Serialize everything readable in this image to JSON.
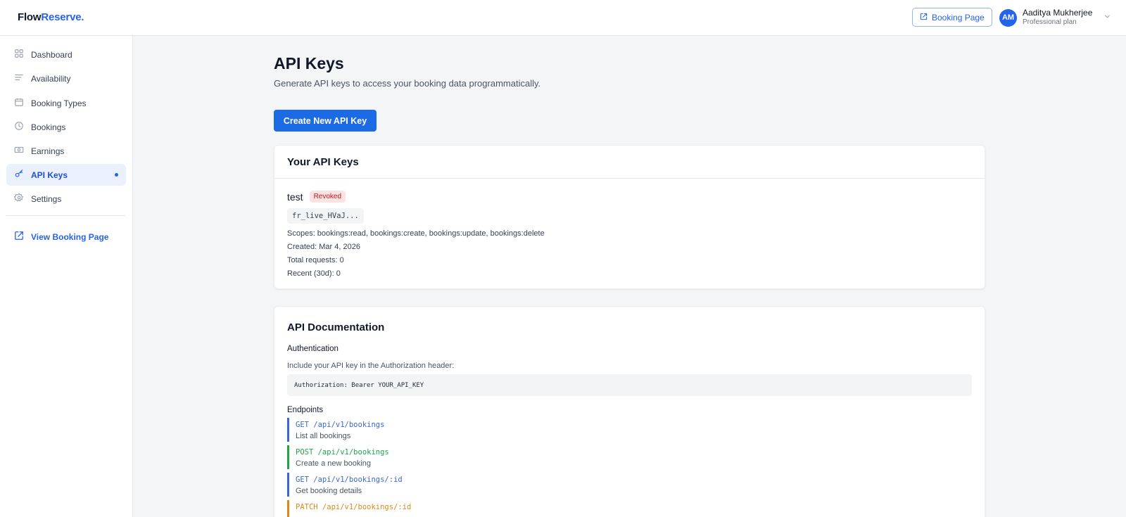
{
  "header": {
    "logo_part1": "Flow",
    "logo_part2": "Reserve.",
    "booking_button": "Booking Page",
    "user": {
      "initials": "AM",
      "name": "Aaditya Mukherjee",
      "plan": "Professional plan"
    }
  },
  "sidebar": {
    "items": [
      {
        "label": "Dashboard",
        "icon": "grid-icon"
      },
      {
        "label": "Availability",
        "icon": "lines-icon"
      },
      {
        "label": "Booking Types",
        "icon": "calendar-icon"
      },
      {
        "label": "Bookings",
        "icon": "clock-icon"
      },
      {
        "label": "Earnings",
        "icon": "money-icon"
      },
      {
        "label": "API Keys",
        "icon": "key-icon",
        "active": true
      },
      {
        "label": "Settings",
        "icon": "gear-icon"
      }
    ],
    "view_link": "View Booking Page"
  },
  "main": {
    "title": "API Keys",
    "subtitle": "Generate API keys to access your booking data programmatically.",
    "create_button": "Create New API Key",
    "keys_card": {
      "title": "Your API Keys",
      "key": {
        "name": "test",
        "status": "Revoked",
        "prefix": "fr_live_HVaJ...",
        "scopes": "Scopes: bookings:read, bookings:create, bookings:update, bookings:delete",
        "created": "Created: Mar 4, 2026",
        "total_requests": "Total requests: 0",
        "recent": "Recent (30d): 0"
      }
    },
    "docs_card": {
      "title": "API Documentation",
      "auth_heading": "Authentication",
      "auth_text": "Include your API key in the Authorization header:",
      "auth_code": "Authorization: Bearer YOUR_API_KEY",
      "endpoints_heading": "Endpoints",
      "endpoints": [
        {
          "code": "GET /api/v1/bookings",
          "desc": "List all bookings",
          "color": "#3b66d6"
        },
        {
          "code": "POST /api/v1/bookings",
          "desc": "Create a new booking",
          "color": "#22a34a"
        },
        {
          "code": "GET /api/v1/bookings/:id",
          "desc": "Get booking details",
          "color": "#3b66d6"
        },
        {
          "code": "PATCH /api/v1/bookings/:id",
          "desc": "",
          "color": "#d98a1c"
        }
      ]
    }
  },
  "colors": {
    "accent": "#2563eb",
    "revoked_bg": "#fde2e2",
    "revoked_text": "#b91c1c"
  }
}
